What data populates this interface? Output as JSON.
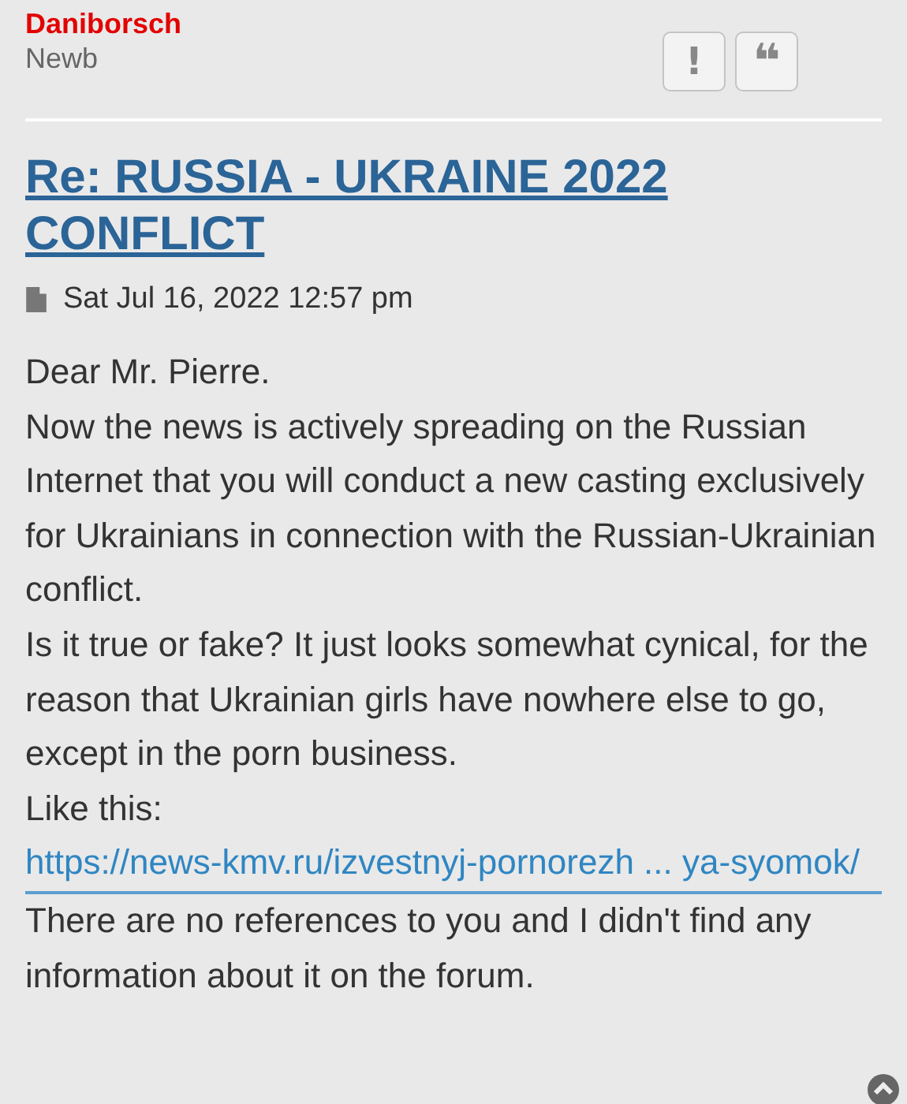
{
  "author": {
    "name": "Daniborsch",
    "rank": "Newb"
  },
  "actions": [
    {
      "kind": "report",
      "label": "!"
    },
    {
      "kind": "quote",
      "label": "❝"
    }
  ],
  "post": {
    "title": "Re: RUSSIA - UKRAINE 2022 CONFLICT",
    "date": "Sat Jul 16, 2022 12:57 pm",
    "body": [
      {
        "kind": "text",
        "text": "Dear Mr. Pierre."
      },
      {
        "kind": "text",
        "text": "Now the news is actively spreading on the Russian Internet that you will conduct a new casting exclusively for Ukrainians in connection with the Russian-Ukrainian conflict."
      },
      {
        "kind": "text",
        "text": "Is it true or fake? It just looks somewhat cynical, for the reason that Ukrainian girls have nowhere else to go, except in the porn business."
      },
      {
        "kind": "text",
        "text": "Like this:"
      },
      {
        "kind": "link",
        "text": "https://news-kmv.ru/izvestnyj-pornorezh ... ya-syomok/"
      },
      {
        "kind": "text",
        "text": "There are no references to you and I didn't find any information about it on the forum."
      }
    ]
  }
}
